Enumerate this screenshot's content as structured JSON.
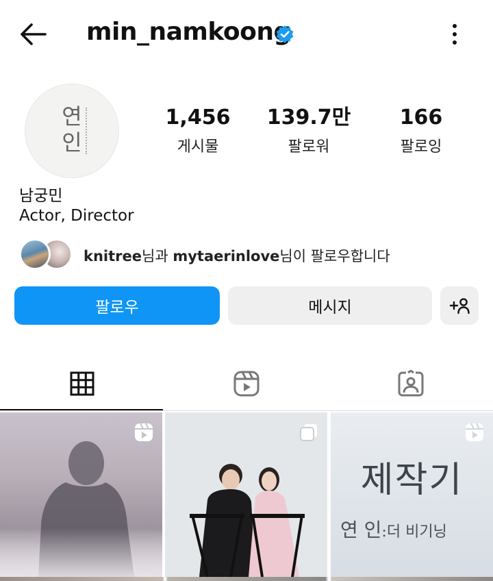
{
  "header": {
    "username": "min_namkoong",
    "back_icon": "arrow-left-icon",
    "verified_icon": "verified-badge-icon",
    "more_icon": "more-vertical-icon",
    "verified_color": "#1d9bf0"
  },
  "profile": {
    "avatar_text": "연\n인",
    "stats": [
      {
        "value": "1,456",
        "label": "게시물"
      },
      {
        "value": "139.7만",
        "label": "팔로워"
      },
      {
        "value": "166",
        "label": "팔로잉"
      }
    ],
    "full_name": "남궁민",
    "bio": "Actor, Director"
  },
  "followed_by": {
    "user1": "knitree",
    "mid": "님과 ",
    "user2": "mytaerinlove",
    "suffix": "님이 팔로우합니다"
  },
  "actions": {
    "follow_label": "팔로우",
    "message_label": "메시지",
    "add_user_icon": "add-person-icon",
    "follow_color": "#0f95f6"
  },
  "tabs": [
    {
      "name": "grid",
      "icon": "grid-icon",
      "active": true
    },
    {
      "name": "reels",
      "icon": "reels-icon",
      "active": false
    },
    {
      "name": "tagged",
      "icon": "tagged-person-icon",
      "active": false
    }
  ],
  "posts": [
    {
      "type": "reel",
      "badge_icon": "reels-icon"
    },
    {
      "type": "carousel",
      "badge_icon": "carousel-icon"
    },
    {
      "type": "reel",
      "badge_icon": "reels-icon",
      "title": "제작기",
      "subtitle_a": "연 인",
      "subtitle_b": ":",
      "subtitle_c": "더 비기닝"
    }
  ]
}
